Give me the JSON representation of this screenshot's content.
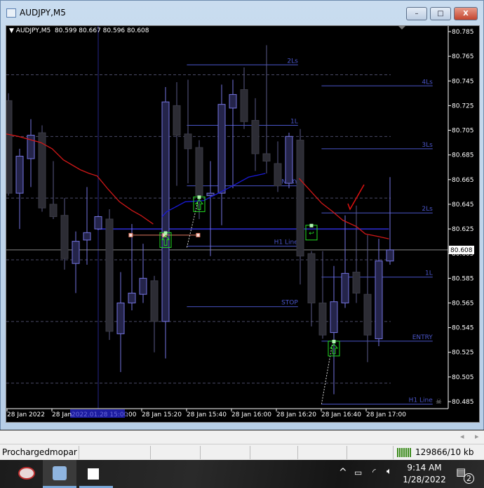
{
  "window": {
    "title": "AUDJPY,M5",
    "minimize": "–",
    "maximize": "□",
    "close": "X"
  },
  "chart_header": {
    "symbol": "AUDJPY,M5",
    "ohlc": "80.599 80.667 80.596 80.608"
  },
  "colors": {
    "bull_border": "#7474e0",
    "bull_fill": "#24244a",
    "bear_fill": "#2c2c34",
    "bear_border": "#3a3a44",
    "level_line": "#4a55c8",
    "ma_red": "#d01818",
    "ma_blue": "#1a1ad8",
    "grid": "#4a4a66",
    "signal_box": "#22dd22",
    "orange_line": "#e07860"
  },
  "chart_data": {
    "type": "candlestick",
    "price_axis": {
      "ticks": [
        "80.785",
        "80.765",
        "80.745",
        "80.725",
        "80.705",
        "80.685",
        "80.665",
        "80.645",
        "80.625",
        "80.605",
        "80.585",
        "80.565",
        "80.545",
        "80.525",
        "80.505",
        "80.485"
      ],
      "range": [
        80.485,
        80.785
      ],
      "current": "80.608"
    },
    "time_axis": {
      "labels": [
        "28 Jan 2022",
        "28 Jan",
        "2022.01.28 15:00",
        ":00",
        "28 Jan 15:20",
        "28 Jan 15:40",
        "28 Jan 16:00",
        "28 Jan 16:20",
        "28 Jan 16:40",
        "28 Jan 17:00"
      ]
    },
    "candles": [
      [
        80.729,
        80.735,
        80.652,
        80.654
      ],
      [
        80.654,
        80.69,
        80.625,
        80.684
      ],
      [
        80.682,
        80.714,
        80.659,
        80.701
      ],
      [
        80.703,
        80.709,
        80.639,
        80.642
      ],
      [
        80.645,
        80.68,
        80.633,
        80.635
      ],
      [
        80.636,
        80.65,
        80.592,
        80.601
      ],
      [
        80.597,
        80.623,
        80.573,
        80.615
      ],
      [
        80.616,
        80.659,
        80.596,
        80.622
      ],
      [
        80.625,
        80.636,
        80.624,
        80.635
      ],
      [
        80.633,
        80.641,
        80.535,
        80.542
      ],
      [
        80.54,
        80.59,
        80.509,
        80.565
      ],
      [
        80.565,
        80.629,
        80.559,
        80.573
      ],
      [
        80.572,
        80.613,
        80.565,
        80.585
      ],
      [
        80.583,
        80.587,
        80.525,
        80.55
      ],
      [
        80.55,
        80.74,
        80.52,
        80.728
      ],
      [
        80.725,
        80.744,
        80.66,
        80.701
      ],
      [
        80.702,
        80.746,
        80.662,
        80.69
      ],
      [
        80.691,
        80.697,
        80.633,
        80.652
      ],
      [
        80.652,
        80.68,
        80.603,
        80.654
      ],
      [
        80.654,
        80.742,
        80.628,
        80.726
      ],
      [
        80.723,
        80.746,
        80.658,
        80.734
      ],
      [
        80.738,
        80.756,
        80.706,
        80.712
      ],
      [
        80.713,
        80.731,
        80.672,
        80.686
      ],
      [
        80.686,
        80.774,
        80.67,
        80.68
      ],
      [
        80.678,
        80.696,
        80.655,
        80.66
      ],
      [
        80.662,
        80.703,
        80.658,
        80.7
      ],
      [
        80.697,
        80.706,
        80.58,
        80.603
      ],
      [
        80.605,
        80.607,
        80.546,
        80.565
      ],
      [
        80.565,
        80.607,
        80.536,
        80.539
      ],
      [
        80.541,
        80.595,
        80.491,
        80.566
      ],
      [
        80.565,
        80.636,
        80.561,
        80.589
      ],
      [
        80.59,
        80.644,
        80.565,
        80.573
      ],
      [
        80.572,
        80.62,
        80.517,
        80.539
      ],
      [
        80.536,
        80.617,
        80.53,
        80.599
      ],
      [
        80.599,
        80.667,
        80.596,
        80.608
      ]
    ],
    "ma_red": [
      [
        -0.2,
        80.702
      ],
      [
        0.9,
        80.7
      ],
      [
        2.9,
        80.695
      ],
      [
        3.9,
        80.69
      ],
      [
        4.9,
        80.681
      ],
      [
        6.4,
        80.673
      ],
      [
        7.2,
        80.67
      ],
      [
        7.9,
        80.668
      ],
      [
        8.9,
        80.657
      ],
      [
        9.9,
        80.647
      ],
      [
        11,
        80.64
      ],
      [
        11.8,
        80.636
      ],
      [
        12.9,
        80.629
      ],
      null,
      [
        25.9,
        80.666
      ],
      [
        27.9,
        80.646
      ],
      [
        28.9,
        80.639
      ],
      [
        29.8,
        80.632
      ],
      [
        31,
        80.627
      ],
      [
        31.8,
        80.621
      ],
      [
        32.9,
        80.619
      ],
      [
        33.9,
        80.617
      ]
    ],
    "ma_blue": [
      [
        13.7,
        80.635
      ],
      [
        14.1,
        80.639
      ],
      [
        15.75,
        80.647
      ],
      [
        17.4,
        80.648
      ],
      [
        18.7,
        80.654
      ],
      [
        20,
        80.66
      ],
      [
        21.4,
        80.667
      ],
      [
        22.9,
        80.67
      ]
    ],
    "levels_left": [
      {
        "label": "2Ls",
        "price": 80.758
      },
      {
        "label": "1L",
        "price": 80.709
      },
      {
        "label": "ENTRY",
        "price": 80.66
      },
      {
        "label": "H1 Line",
        "price": 80.611
      },
      {
        "label": "STOP",
        "price": 80.562
      }
    ],
    "levels_right": [
      {
        "label": "4Ls",
        "price": 80.741
      },
      {
        "label": "3Ls",
        "price": 80.69
      },
      {
        "label": "2Ls",
        "price": 80.638
      },
      {
        "label": "1L",
        "price": 80.586
      },
      {
        "label": "ENTRY",
        "price": 80.534
      },
      {
        "label": "H1 Line",
        "price": 80.483
      }
    ],
    "blue_level": 80.625,
    "orange_level": 80.62,
    "grid_levels": [
      80.75,
      80.7,
      80.65,
      80.6,
      80.55,
      80.5
    ],
    "signals": [
      {
        "idx": 14,
        "type": "buy-arrow"
      },
      {
        "idx": 17,
        "type": "buy-arrow"
      },
      {
        "idx": 27,
        "type": "exit"
      },
      {
        "idx": 29,
        "type": "buy-arrow"
      }
    ]
  },
  "lower": {
    "scroll_left": "◂",
    "scroll_right": "▸"
  },
  "status": {
    "profile": "Prochargedmopar",
    "traffic": "129866/10 kb"
  },
  "taskbar": {
    "time": "9:14 AM",
    "date": "1/28/2022",
    "notifications": "2",
    "chevron": "^"
  }
}
